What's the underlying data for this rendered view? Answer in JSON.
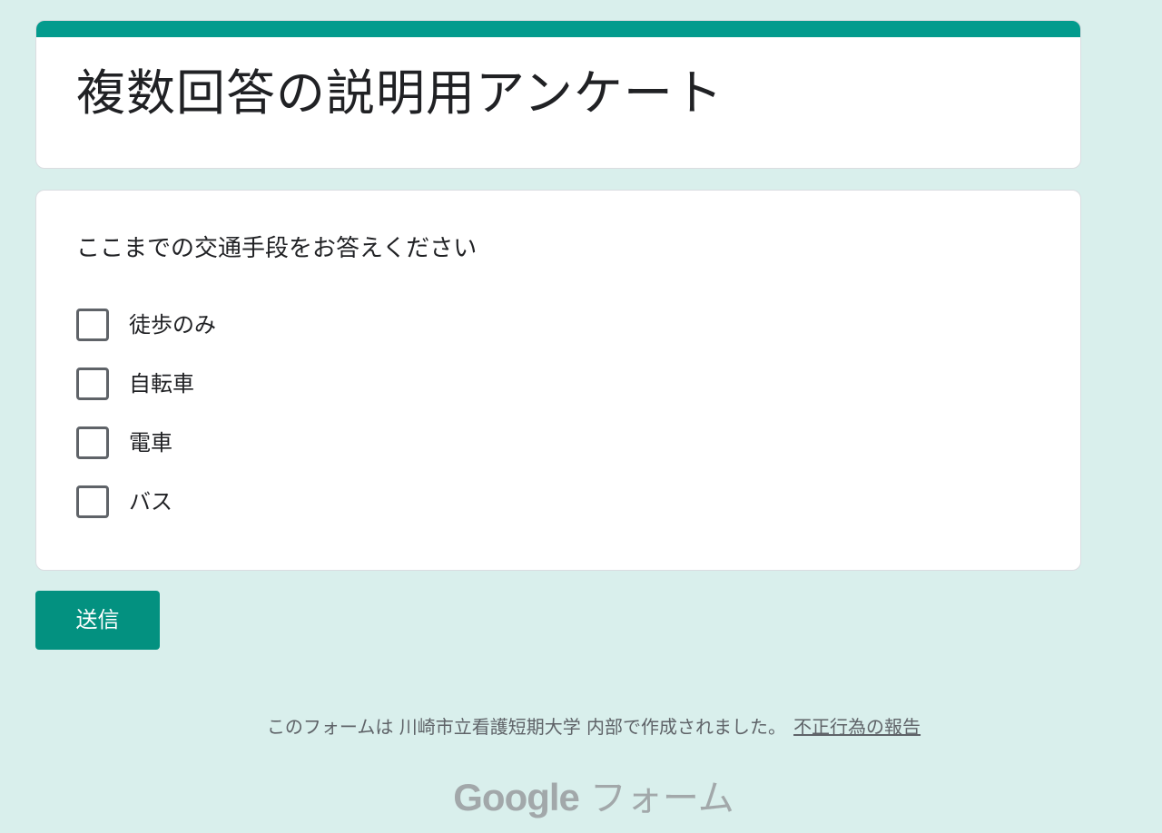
{
  "form": {
    "title": "複数回答の説明用アンケート",
    "accent_color": "#039b8d"
  },
  "question": {
    "title": "ここまでの交通手段をお答えください",
    "options": [
      {
        "label": "徒歩のみ",
        "checked": false
      },
      {
        "label": "自転車",
        "checked": false
      },
      {
        "label": "電車",
        "checked": false
      },
      {
        "label": "バス",
        "checked": false
      }
    ]
  },
  "submit": {
    "label": "送信"
  },
  "footer": {
    "note": "このフォームは 川崎市立看護短期大学 内部で作成されました。",
    "report_link": "不正行為の報告"
  },
  "brand": {
    "google": "Google",
    "product": "フォーム"
  }
}
